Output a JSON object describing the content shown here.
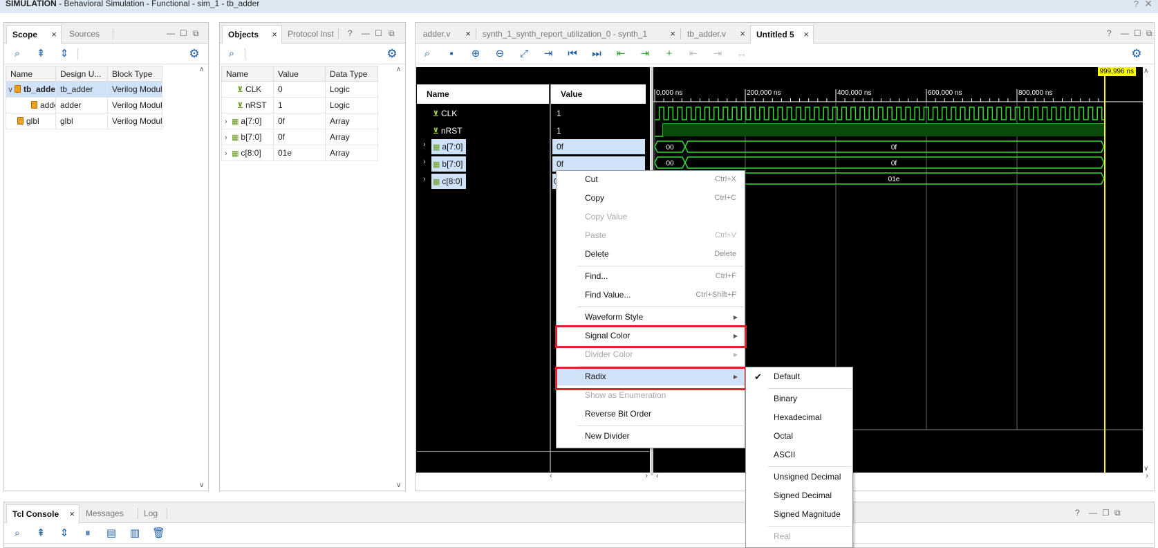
{
  "window": {
    "title_bold": "SIMULATION",
    "title_rest": " - Behavioral Simulation - Functional - sim_1 - tb_adder"
  },
  "scope_panel": {
    "tabs": [
      {
        "label": "Scope"
      },
      {
        "label": "Sources"
      }
    ],
    "columns": [
      "Name",
      "Design U...",
      "Block Type"
    ],
    "rows": [
      {
        "name": "tb_adder",
        "design": "tb_adder",
        "block": "Verilog Module",
        "expanded": true,
        "selected": true
      },
      {
        "name": "adder",
        "design": "adder",
        "block": "Verilog Module"
      },
      {
        "name": "glbl",
        "design": "glbl",
        "block": "Verilog Module"
      }
    ]
  },
  "objects_panel": {
    "tabs": [
      {
        "label": "Objects"
      },
      {
        "label": "Protocol Inst"
      }
    ],
    "columns": [
      "Name",
      "Value",
      "Data Type"
    ],
    "rows": [
      {
        "name": "CLK",
        "value": "0",
        "type": "Logic"
      },
      {
        "name": "nRST",
        "value": "1",
        "type": "Logic"
      },
      {
        "name": "a[7:0]",
        "value": "0f",
        "type": "Array"
      },
      {
        "name": "b[7:0]",
        "value": "0f",
        "type": "Array"
      },
      {
        "name": "c[8:0]",
        "value": "01e",
        "type": "Array"
      }
    ]
  },
  "editor_tabs": [
    {
      "label": "adder.v"
    },
    {
      "label": "synth_1_synth_report_utilization_0 - synth_1"
    },
    {
      "label": "tb_adder.v"
    },
    {
      "label": "Untitled 5"
    }
  ],
  "waveform": {
    "name_header": "Name",
    "value_header": "Value",
    "cursor_label": "999,996 ns",
    "time_ticks": [
      "0,000 ns",
      "200,000 ns",
      "400,000 ns",
      "600,000 ns",
      "800,000 ns"
    ],
    "signals": [
      {
        "name": "CLK",
        "value": "1"
      },
      {
        "name": "nRST",
        "value": "1"
      },
      {
        "name": "a[7:0]",
        "value": "0f",
        "seg1": "00",
        "seg2": "0f"
      },
      {
        "name": "b[7:0]",
        "value": "0f",
        "seg1": "00",
        "seg2": "0f"
      },
      {
        "name": "c[8:0]",
        "value": "0",
        "seg2": "01e"
      }
    ]
  },
  "context_menu": {
    "items": [
      {
        "label": "Cut",
        "shortcut": "Ctrl+X"
      },
      {
        "label": "Copy",
        "shortcut": "Ctrl+C"
      },
      {
        "label": "Copy Value"
      },
      {
        "label": "Paste",
        "shortcut": "Ctrl+V"
      },
      {
        "label": "Delete",
        "shortcut": "Delete"
      },
      {
        "label": "Find...",
        "shortcut": "Ctrl+F"
      },
      {
        "label": "Find Value...",
        "shortcut": "Ctrl+Shift+F"
      },
      {
        "label": "Waveform Style"
      },
      {
        "label": "Signal Color"
      },
      {
        "label": "Divider Color"
      },
      {
        "label": "Radix"
      },
      {
        "label": "Show as Enumeration"
      },
      {
        "label": "Reverse Bit Order"
      },
      {
        "label": "New Divider"
      }
    ]
  },
  "radix_submenu": {
    "items": [
      {
        "label": "Default",
        "checked": true
      },
      {
        "label": "Binary"
      },
      {
        "label": "Hexadecimal"
      },
      {
        "label": "Octal"
      },
      {
        "label": "ASCII"
      },
      {
        "label": "Unsigned Decimal"
      },
      {
        "label": "Signed Decimal"
      },
      {
        "label": "Signed Magnitude"
      },
      {
        "label": "Real"
      }
    ]
  },
  "console_panel": {
    "tabs": [
      {
        "label": "Tcl Console"
      },
      {
        "label": "Messages"
      },
      {
        "label": "Log"
      }
    ]
  },
  "colors": {
    "accent": "#1d5fa8",
    "waveform_green": "#33dd33",
    "highlight_red": "#e0202a",
    "selection": "#cfe2f8"
  }
}
